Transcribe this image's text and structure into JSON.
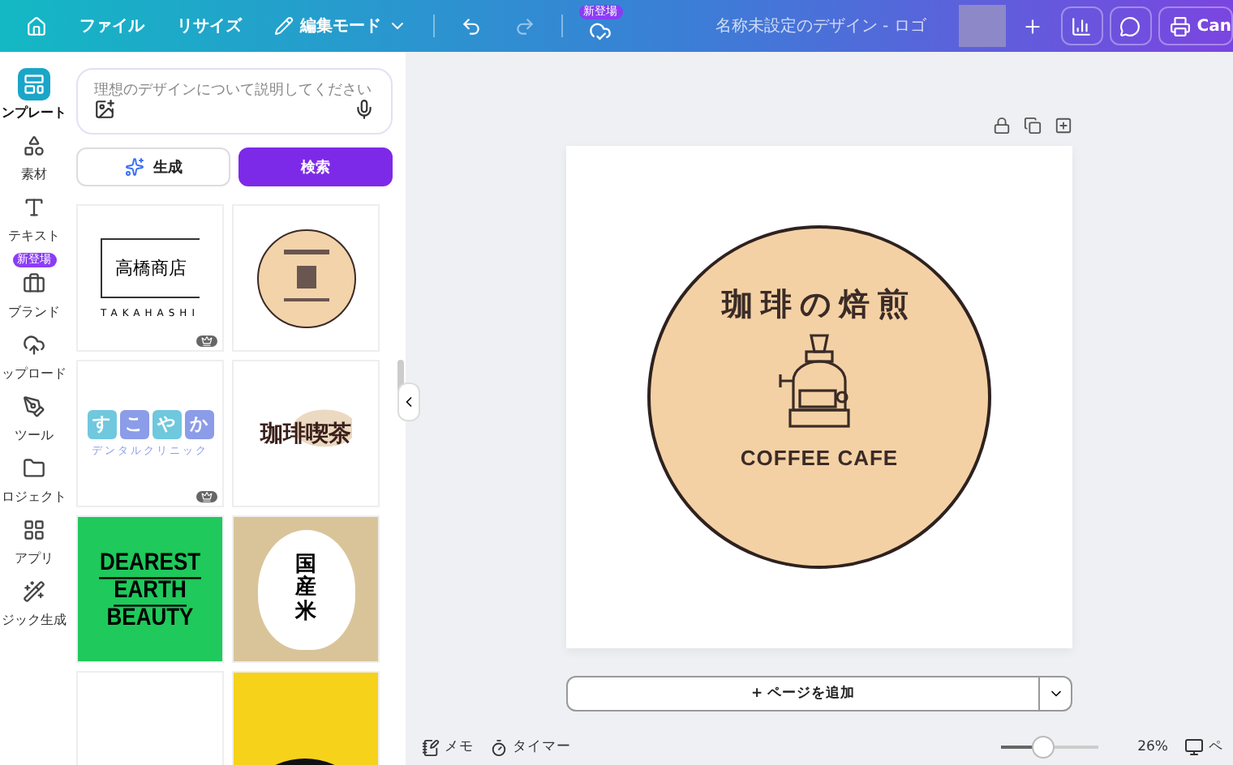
{
  "topbar": {
    "menu": [
      "ファイル",
      "リサイズ"
    ],
    "edit_mode": "編集モード",
    "new_badge": "新登場",
    "title": "名称未設定のデザイン - ロゴ",
    "share_button": "Can"
  },
  "rail": [
    {
      "label": "ンプレート",
      "selected": true
    },
    {
      "label": "素材",
      "selected": false
    },
    {
      "label": "テキスト",
      "selected": false
    },
    {
      "label": "ブランド",
      "selected": false,
      "badge": "新登場"
    },
    {
      "label": "ップロード",
      "selected": false
    },
    {
      "label": "ツール",
      "selected": false
    },
    {
      "label": "ロジェクト",
      "selected": false
    },
    {
      "label": "アプリ",
      "selected": false
    },
    {
      "label": "ジック生成",
      "selected": false
    }
  ],
  "prompt": {
    "placeholder": "理想のデザインについて説明してください"
  },
  "modes": [
    {
      "label": "生成",
      "selected": false
    },
    {
      "label": "検索",
      "selected": true
    }
  ],
  "templates": [
    {
      "kind": "frame",
      "texts": [
        "高橋商店",
        "TAKAHASHI"
      ],
      "premium": true
    },
    {
      "kind": "coffee-circle",
      "premium": false
    },
    {
      "kind": "blocks",
      "texts": [
        "す",
        "こ",
        "や",
        "か",
        "デンタルクリニック"
      ],
      "premium": true
    },
    {
      "kind": "bean",
      "texts": [
        "珈琲喫茶"
      ],
      "premium": false
    },
    {
      "kind": "green",
      "texts": [
        "DEAREST",
        "EARTH",
        "BEAUTY"
      ],
      "premium": false
    },
    {
      "kind": "rice",
      "texts": [
        "国産米"
      ],
      "premium": false
    },
    {
      "kind": "plain"
    },
    {
      "kind": "rock"
    }
  ],
  "design": {
    "arc_title": "珈琲の焙煎",
    "subtitle": "COFFEE CAFE"
  },
  "add_page": "+ ページを追加",
  "footer": {
    "notes": "メモ",
    "timer": "タイマー",
    "zoom": {
      "level": 0.43,
      "reading": "26%"
    },
    "pages": "ペ"
  }
}
